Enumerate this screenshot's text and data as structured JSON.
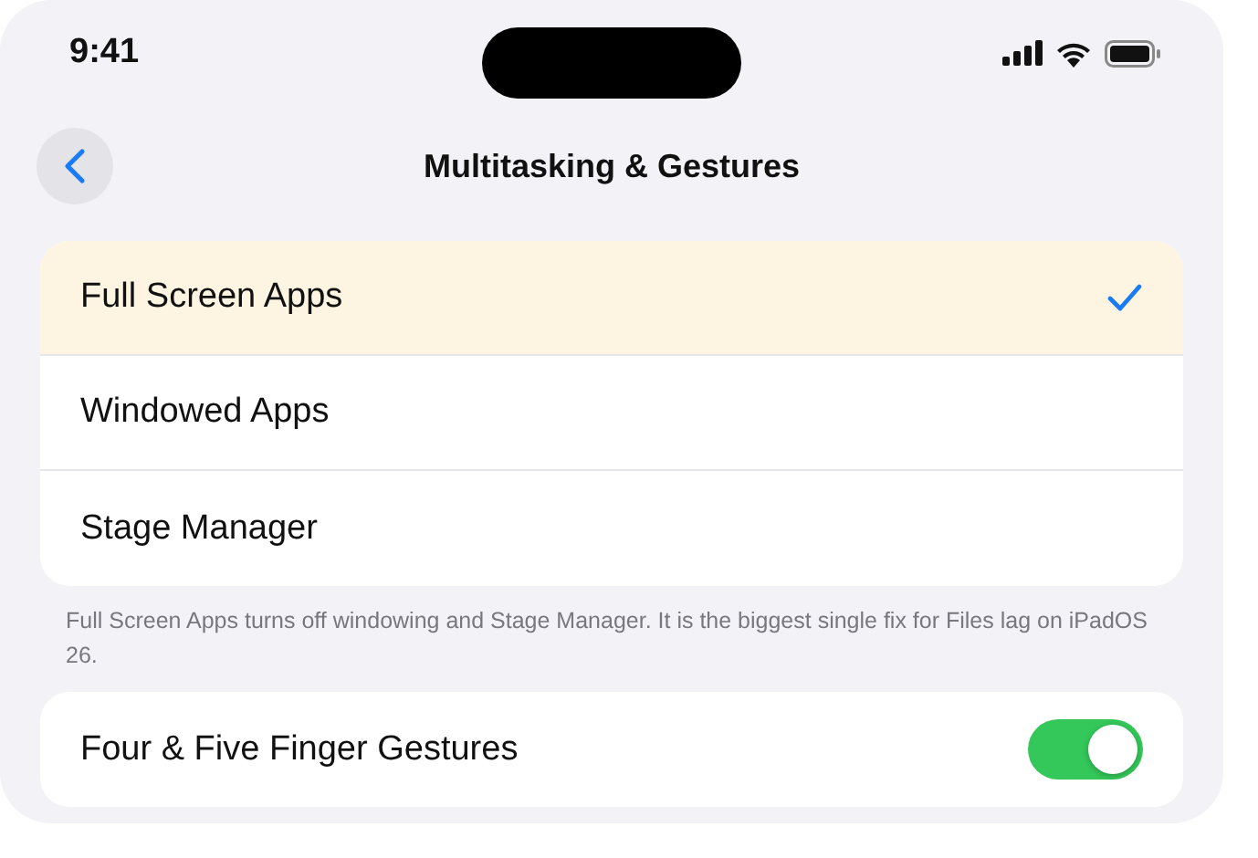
{
  "status_bar": {
    "time": "9:41"
  },
  "nav": {
    "title": "Multitasking & Gestures"
  },
  "options": [
    {
      "label": "Full Screen Apps",
      "selected": true
    },
    {
      "label": "Windowed Apps",
      "selected": false
    },
    {
      "label": "Stage Manager",
      "selected": false
    }
  ],
  "footer": "Full Screen Apps turns off windowing and Stage Manager. It is the biggest single fix for Files lag on iPadOS 26.",
  "toggles": [
    {
      "label": "Four & Five Finger Gestures",
      "on": true
    }
  ]
}
